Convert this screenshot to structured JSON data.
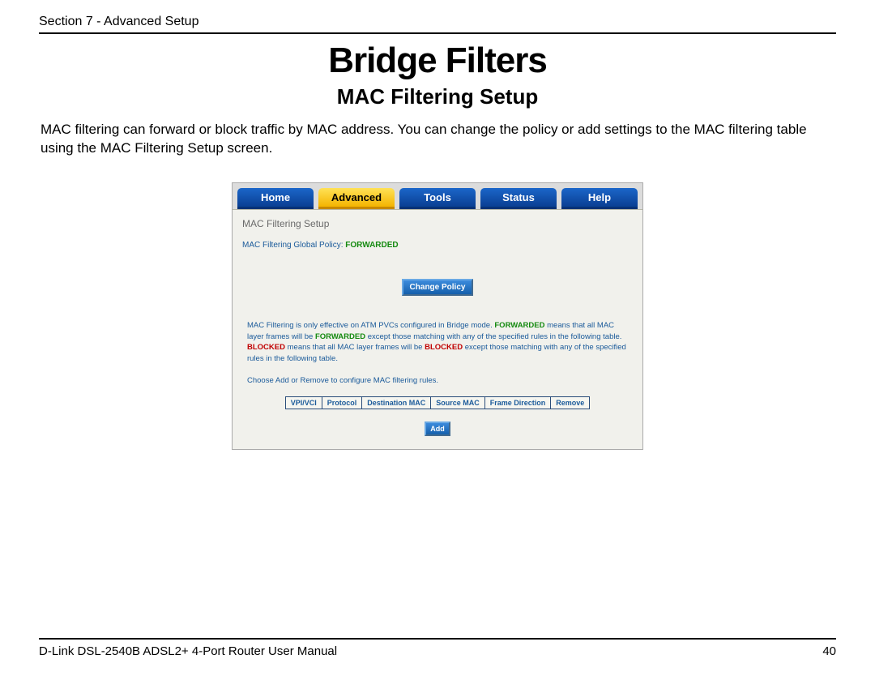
{
  "header": {
    "section": "Section 7 - Advanced Setup"
  },
  "title": "Bridge Filters",
  "subtitle": "MAC Filtering Setup",
  "lead": "MAC filtering can forward or block traffic by MAC address. You can change the policy or add settings to the MAC filtering table using the MAC Filtering Setup screen.",
  "ui": {
    "tabs": {
      "home": "Home",
      "advanced": "Advanced",
      "tools": "Tools",
      "status": "Status",
      "help": "Help"
    },
    "panel_title": "MAC Filtering Setup",
    "policy_label": "MAC Filtering Global Policy: ",
    "policy_value": "FORWARDED",
    "change_policy_btn": "Change Policy",
    "explain": {
      "p1a": "MAC Filtering is only effective on ATM PVCs configured in Bridge mode. ",
      "kw_fwd": "FORWARDED",
      "p1b": " means that all MAC layer frames will be ",
      "kw_fwd2": "FORWARDED",
      "p1c": " except those matching with any of the specified rules in the following table. ",
      "kw_blk": "BLOCKED",
      "p1d": " means that all MAC layer frames will be ",
      "kw_blk2": "BLOCKED",
      "p1e": " except those matching with any of the specified rules in the following table."
    },
    "choose_line": "Choose Add or Remove to configure MAC filtering rules.",
    "table_headers": {
      "vpivci": "VPI/VCI",
      "protocol": "Protocol",
      "destmac": "Destination MAC",
      "srcmac": "Source MAC",
      "framedir": "Frame Direction",
      "remove": "Remove"
    },
    "add_btn": "Add"
  },
  "footer": {
    "manual": "D-Link DSL-2540B ADSL2+ 4-Port Router User Manual",
    "page": "40"
  }
}
